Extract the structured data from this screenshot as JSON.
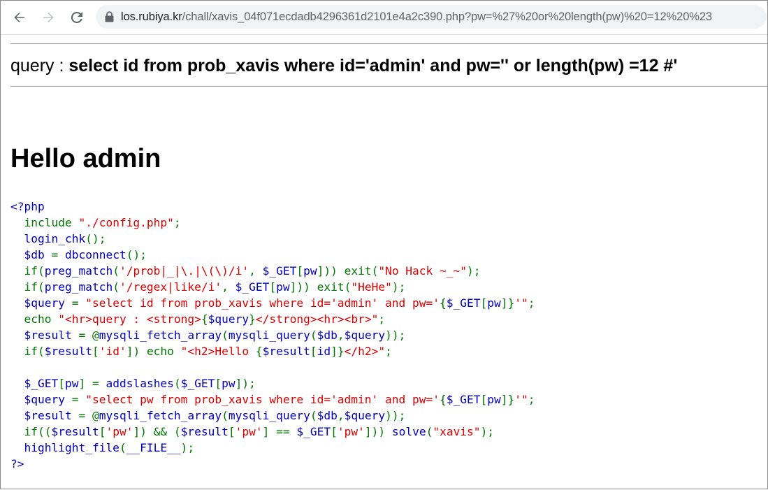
{
  "browser": {
    "url_host": "los.rubiya.kr",
    "url_path": "/chall/xavis_04f071ecdadb4296361d2101e4a2c390.php?pw=%27%20or%20length(pw)%20=12%20%23"
  },
  "page": {
    "query_prefix": "query : ",
    "query_text": "select id from prob_xavis where id='admin' and pw='' or length(pw) =12 #'",
    "hello_text": "Hello admin"
  },
  "code": {
    "lines": [
      [
        [
          "c-blue",
          "<?php"
        ]
      ],
      [
        [
          "c-green",
          "  include "
        ],
        [
          "c-red",
          "\"./config.php\""
        ],
        [
          "c-green",
          ";"
        ]
      ],
      [
        [
          "c-blue",
          "  login_chk"
        ],
        [
          "c-green",
          "();"
        ]
      ],
      [
        [
          "c-blue",
          "  $db "
        ],
        [
          "c-green",
          "= "
        ],
        [
          "c-blue",
          "dbconnect"
        ],
        [
          "c-green",
          "();"
        ]
      ],
      [
        [
          "c-green",
          "  if("
        ],
        [
          "c-blue",
          "preg_match"
        ],
        [
          "c-green",
          "("
        ],
        [
          "c-red",
          "'/prob|_|\\.|\\(\\)/i'"
        ],
        [
          "c-green",
          ", "
        ],
        [
          "c-blue",
          "$_GET"
        ],
        [
          "c-green",
          "["
        ],
        [
          "c-blue",
          "pw"
        ],
        [
          "c-green",
          "])) exit("
        ],
        [
          "c-red",
          "\"No Hack ~_~\""
        ],
        [
          "c-green",
          ");"
        ]
      ],
      [
        [
          "c-green",
          "  if("
        ],
        [
          "c-blue",
          "preg_match"
        ],
        [
          "c-green",
          "("
        ],
        [
          "c-red",
          "'/regex|like/i'"
        ],
        [
          "c-green",
          ", "
        ],
        [
          "c-blue",
          "$_GET"
        ],
        [
          "c-green",
          "["
        ],
        [
          "c-blue",
          "pw"
        ],
        [
          "c-green",
          "])) exit("
        ],
        [
          "c-red",
          "\"HeHe\""
        ],
        [
          "c-green",
          ");"
        ]
      ],
      [
        [
          "c-blue",
          "  $query "
        ],
        [
          "c-green",
          "= "
        ],
        [
          "c-red",
          "\"select id from prob_xavis where id='admin' and pw='"
        ],
        [
          "c-green",
          "{"
        ],
        [
          "c-blue",
          "$_GET"
        ],
        [
          "c-green",
          "["
        ],
        [
          "c-blue",
          "pw"
        ],
        [
          "c-green",
          "]}"
        ],
        [
          "c-red",
          "'\""
        ],
        [
          "c-green",
          ";"
        ]
      ],
      [
        [
          "c-green",
          "  echo "
        ],
        [
          "c-red",
          "\"<hr>query : <strong>"
        ],
        [
          "c-green",
          "{"
        ],
        [
          "c-blue",
          "$query"
        ],
        [
          "c-green",
          "}"
        ],
        [
          "c-red",
          "</strong><hr><br>\""
        ],
        [
          "c-green",
          ";"
        ]
      ],
      [
        [
          "c-blue",
          "  $result "
        ],
        [
          "c-green",
          "= @"
        ],
        [
          "c-blue",
          "mysqli_fetch_array"
        ],
        [
          "c-green",
          "("
        ],
        [
          "c-blue",
          "mysqli_query"
        ],
        [
          "c-green",
          "("
        ],
        [
          "c-blue",
          "$db"
        ],
        [
          "c-green",
          ","
        ],
        [
          "c-blue",
          "$query"
        ],
        [
          "c-green",
          "));"
        ]
      ],
      [
        [
          "c-green",
          "  if("
        ],
        [
          "c-blue",
          "$result"
        ],
        [
          "c-green",
          "["
        ],
        [
          "c-red",
          "'id'"
        ],
        [
          "c-green",
          "]) echo "
        ],
        [
          "c-red",
          "\"<h2>Hello "
        ],
        [
          "c-green",
          "{"
        ],
        [
          "c-blue",
          "$result"
        ],
        [
          "c-green",
          "["
        ],
        [
          "c-blue",
          "id"
        ],
        [
          "c-green",
          "]}"
        ],
        [
          "c-red",
          "</h2>\""
        ],
        [
          "c-green",
          ";"
        ]
      ],
      [
        [
          "c-blue",
          " "
        ]
      ],
      [
        [
          "c-blue",
          "  $_GET"
        ],
        [
          "c-green",
          "["
        ],
        [
          "c-blue",
          "pw"
        ],
        [
          "c-green",
          "] = "
        ],
        [
          "c-blue",
          "addslashes"
        ],
        [
          "c-green",
          "("
        ],
        [
          "c-blue",
          "$_GET"
        ],
        [
          "c-green",
          "["
        ],
        [
          "c-blue",
          "pw"
        ],
        [
          "c-green",
          "]);"
        ]
      ],
      [
        [
          "c-blue",
          "  $query "
        ],
        [
          "c-green",
          "= "
        ],
        [
          "c-red",
          "\"select pw from prob_xavis where id='admin' and pw='"
        ],
        [
          "c-green",
          "{"
        ],
        [
          "c-blue",
          "$_GET"
        ],
        [
          "c-green",
          "["
        ],
        [
          "c-blue",
          "pw"
        ],
        [
          "c-green",
          "]}"
        ],
        [
          "c-red",
          "'\""
        ],
        [
          "c-green",
          ";"
        ]
      ],
      [
        [
          "c-blue",
          "  $result "
        ],
        [
          "c-green",
          "= @"
        ],
        [
          "c-blue",
          "mysqli_fetch_array"
        ],
        [
          "c-green",
          "("
        ],
        [
          "c-blue",
          "mysqli_query"
        ],
        [
          "c-green",
          "("
        ],
        [
          "c-blue",
          "$db"
        ],
        [
          "c-green",
          ","
        ],
        [
          "c-blue",
          "$query"
        ],
        [
          "c-green",
          "));"
        ]
      ],
      [
        [
          "c-green",
          "  if(("
        ],
        [
          "c-blue",
          "$result"
        ],
        [
          "c-green",
          "["
        ],
        [
          "c-red",
          "'pw'"
        ],
        [
          "c-green",
          "]) && ("
        ],
        [
          "c-blue",
          "$result"
        ],
        [
          "c-green",
          "["
        ],
        [
          "c-red",
          "'pw'"
        ],
        [
          "c-green",
          "] == "
        ],
        [
          "c-blue",
          "$_GET"
        ],
        [
          "c-green",
          "["
        ],
        [
          "c-red",
          "'pw'"
        ],
        [
          "c-green",
          "])) "
        ],
        [
          "c-blue",
          "solve"
        ],
        [
          "c-green",
          "("
        ],
        [
          "c-red",
          "\"xavis\""
        ],
        [
          "c-green",
          ");"
        ]
      ],
      [
        [
          "c-blue",
          "  highlight_file"
        ],
        [
          "c-green",
          "("
        ],
        [
          "c-blue",
          "__FILE__"
        ],
        [
          "c-green",
          ");"
        ]
      ],
      [
        [
          "c-blue",
          "?>"
        ]
      ]
    ]
  },
  "icons": {
    "back": "back-arrow-icon",
    "forward": "forward-arrow-icon",
    "reload": "reload-icon",
    "lock": "lock-icon"
  },
  "colors": {
    "php_default": "#0000bb",
    "php_keyword": "#007700",
    "php_string": "#dd0000"
  }
}
